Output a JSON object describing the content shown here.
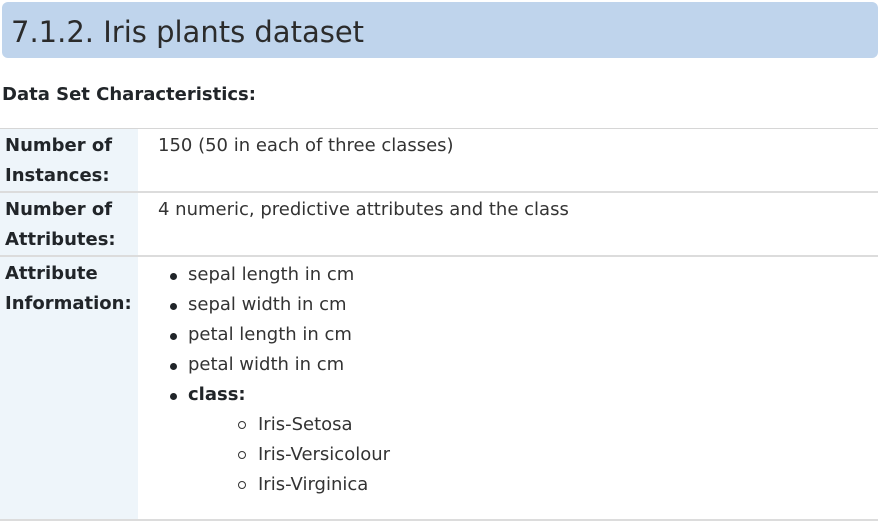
{
  "header": {
    "title": "7.1.2. Iris plants dataset"
  },
  "section": {
    "label": "Data Set Characteristics:"
  },
  "rows": {
    "instances": {
      "name_line1": "Number of",
      "name_line2": "Instances:",
      "value": "150 (50 in each of three classes)"
    },
    "attributes": {
      "name_line1": "Number of",
      "name_line2": "Attributes:",
      "value": "4 numeric, predictive attributes and the class"
    },
    "info": {
      "name_line1": "Attribute",
      "name_line2": "Information:",
      "items": [
        "sepal length in cm",
        "sepal width in cm",
        "petal length in cm",
        "petal width in cm"
      ],
      "class_label": "class:",
      "classes": [
        "Iris-Setosa",
        "Iris-Versicolour",
        "Iris-Virginica"
      ]
    }
  },
  "colors": {
    "title_background": "#bfd4ec",
    "field_name_background": "#eef5fa",
    "row_border": "#dcdcdc"
  }
}
